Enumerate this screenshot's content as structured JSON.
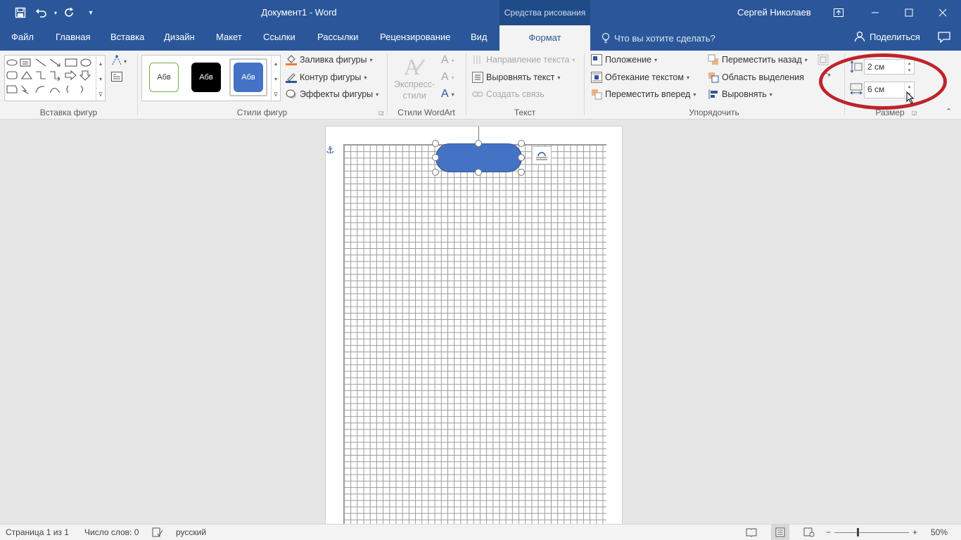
{
  "titlebar": {
    "doc_title": "Документ1  -  Word",
    "context_tool": "Средства рисования",
    "user": "Сергей Николаев"
  },
  "tabs": [
    "Файл",
    "Главная",
    "Вставка",
    "Дизайн",
    "Макет",
    "Ссылки",
    "Рассылки",
    "Рецензирование",
    "Вид"
  ],
  "active_tab": "Формат",
  "tell_me": "Что вы хотите сделать?",
  "share": "Поделиться",
  "ribbon": {
    "insert_shapes_label": "Вставка фигур",
    "shape_styles_label": "Стили фигур",
    "style_swatches": [
      "Абв",
      "Абв",
      "Абв"
    ],
    "shape_fill": "Заливка фигуры",
    "shape_outline": "Контур фигуры",
    "shape_effects": "Эффекты фигуры",
    "wordart_label": "Стили WordArt",
    "express_styles_line1": "Экспресс-",
    "express_styles_line2": "стили",
    "text_label": "Текст",
    "text_direction": "Направление текста",
    "align_text": "Выровнять текст",
    "create_link": "Создать связь",
    "arrange_label": "Упорядочить",
    "position": "Положение",
    "wrap_text": "Обтекание текстом",
    "bring_forward": "Переместить вперед",
    "send_backward": "Переместить назад",
    "selection_pane": "Область выделения",
    "align": "Выровнять",
    "size_label": "Размер",
    "height_value": "2 см",
    "width_value": "6 см"
  },
  "status": {
    "page": "Страница 1 из 1",
    "words": "Число слов: 0",
    "language": "русский",
    "zoom": "50%",
    "zoom_level": 0.3
  },
  "colors": {
    "brand": "#2b579a",
    "shape_fill": "#4472c4",
    "annotation": "#c0232a"
  }
}
